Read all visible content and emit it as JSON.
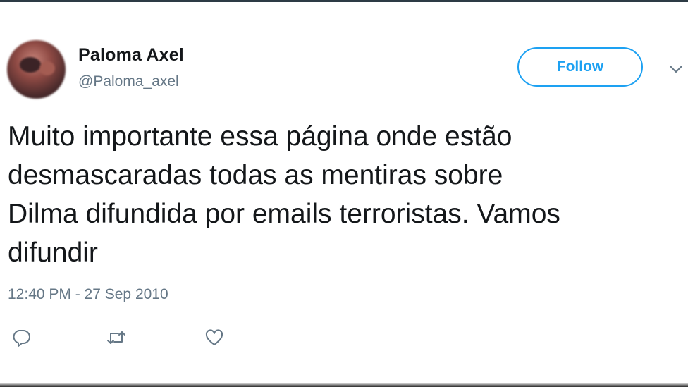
{
  "tweet": {
    "display_name": "Paloma Axel",
    "handle": "@Paloma_axel",
    "follow_label": "Follow",
    "text": "Muito importante essa página onde estão\ndesmascaradas todas as mentiras sobre\nDilma difundida por emails terroristas. Vamos\ndifundir",
    "timestamp": "12:40 PM - 27 Sep 2010"
  },
  "icons": {
    "menu": "chevron-down-icon",
    "reply": "reply-icon",
    "retweet": "retweet-icon",
    "like": "heart-icon"
  },
  "colors": {
    "accent": "#1da1f2",
    "text": "#14171a",
    "secondary_text": "#657786",
    "icon": "#657786"
  }
}
